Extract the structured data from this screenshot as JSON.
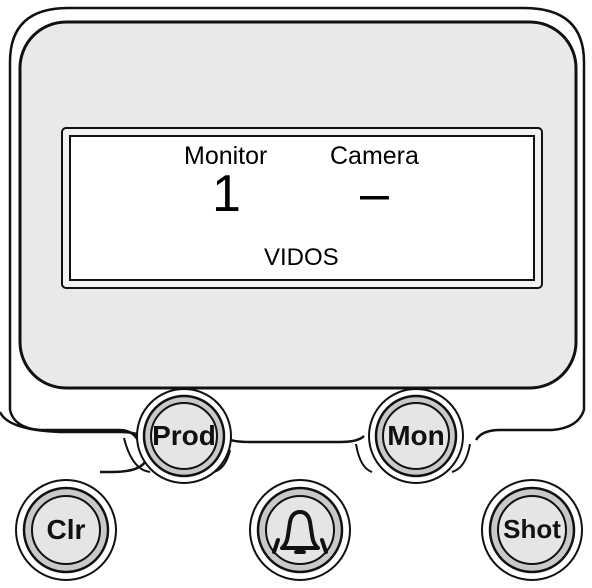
{
  "display": {
    "monitor_label": "Monitor",
    "camera_label": "Camera",
    "monitor_value": "1",
    "camera_value": "–",
    "system_name": "VIDOS"
  },
  "buttons": {
    "prod": "Prod",
    "mon": "Mon",
    "clr": "Clr",
    "shot": "Shot",
    "bell_icon": "bell-icon"
  },
  "colors": {
    "bezel": "#ffffff",
    "screen_frame": "#e8e8e8",
    "display_bg": "#f4f4f4",
    "button_fill": "#d9d9d9",
    "outline": "#111111"
  }
}
